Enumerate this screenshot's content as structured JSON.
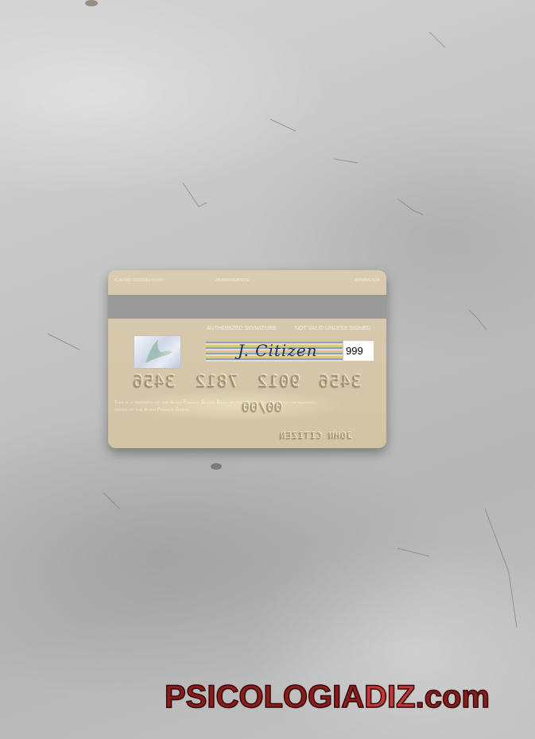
{
  "card": {
    "top_code_left": "ICA0000 000000H 00:00",
    "top_code_center": "#BANKWEBSITE",
    "top_code_right": "RPMWCN00",
    "authorized_signature_label": "AUTHORIZED SIGNATURE",
    "not_valid_label": "NOT VALID UNLESS SIGNED",
    "signature": "J. Citizen",
    "cvv": "999",
    "number_groups": [
      "3456",
      "7812",
      "9012",
      "3456"
    ],
    "expiry": "00/00",
    "disclaimer": "This is a property of the Alios Finance Gabon Bank. If found, please return to the nearest office of the Alios Finance Gabon.",
    "holder_name": "JOHN CITIZEN"
  },
  "watermark": {
    "part1": "PSICOLOGIA",
    "part2": "DIZ",
    "part3": ".com"
  },
  "colors": {
    "card": "#d6c7aa",
    "stripe": "#9a9a9a",
    "watermark_dark": "#8a1c1c",
    "watermark_light": "#c43838"
  }
}
